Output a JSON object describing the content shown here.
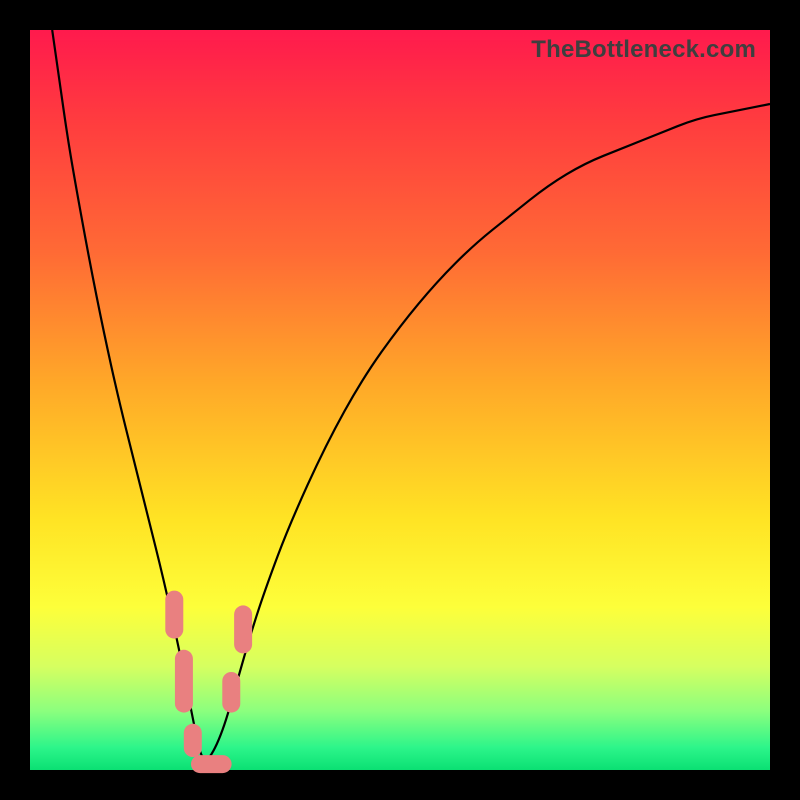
{
  "watermark": "TheBottleneck.com",
  "colors": {
    "frame": "#000000",
    "curve": "#000000",
    "marker": "#e98080",
    "gradient_stops": [
      "#ff1a4d",
      "#ff3b3f",
      "#ff6a35",
      "#ffa928",
      "#ffe324",
      "#fdff3a",
      "#d6ff60",
      "#8cff7e",
      "#2cf58a",
      "#0be073"
    ]
  },
  "chart_data": {
    "type": "line",
    "title": "",
    "xlabel": "",
    "ylabel": "",
    "xlim": [
      0,
      100
    ],
    "ylim": [
      0,
      100
    ],
    "series": [
      {
        "name": "bottleneck-curve",
        "x": [
          3,
          4,
          5,
          6,
          8,
          10,
          12,
          14,
          16,
          18,
          20,
          21,
          22,
          23,
          24,
          26,
          28,
          30,
          32,
          35,
          40,
          45,
          50,
          55,
          60,
          65,
          70,
          75,
          80,
          85,
          90,
          95,
          100
        ],
        "values": [
          100,
          93,
          86,
          80,
          69,
          59,
          50,
          42,
          34,
          26,
          17,
          12,
          7,
          2,
          1,
          5,
          12,
          19,
          25,
          33,
          44,
          53,
          60,
          66,
          71,
          75,
          79,
          82,
          84,
          86,
          88,
          89,
          90
        ]
      }
    ],
    "annotations": {
      "marker_clusters": [
        {
          "side": "left",
          "segments": [
            {
              "x": 19.5,
              "y_start": 24,
              "y_end": 18
            },
            {
              "x": 20.8,
              "y_start": 16,
              "y_end": 8
            },
            {
              "x": 22.0,
              "y_start": 6,
              "y_end": 2
            }
          ]
        },
        {
          "side": "bottom",
          "segments": [
            {
              "x_start": 22,
              "x_end": 27,
              "y": 0.8
            }
          ]
        },
        {
          "side": "right",
          "segments": [
            {
              "x": 27.2,
              "y_start": 8,
              "y_end": 13
            },
            {
              "x": 28.8,
              "y_start": 16,
              "y_end": 22
            }
          ]
        }
      ]
    }
  }
}
